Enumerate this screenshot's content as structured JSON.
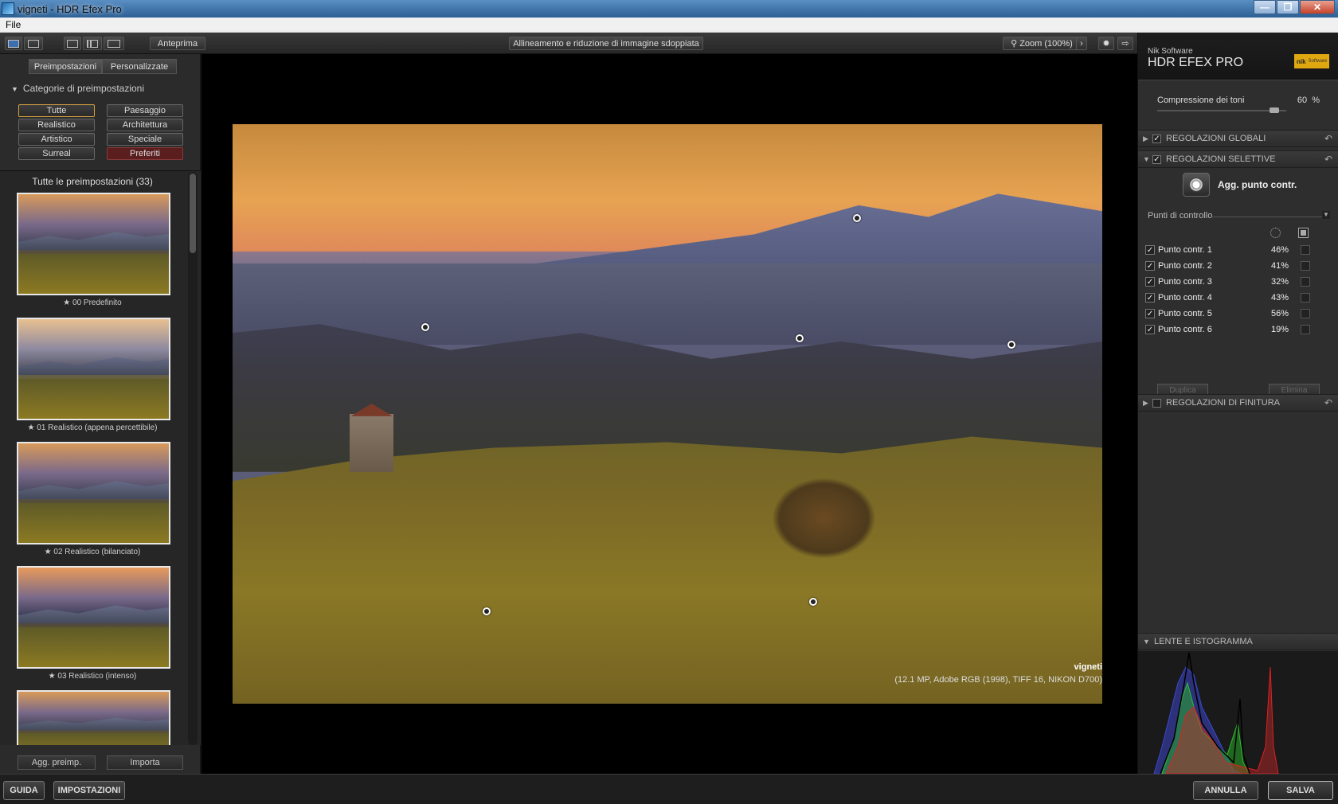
{
  "window": {
    "title": "vigneti - HDR Efex Pro"
  },
  "menu": {
    "file": "File"
  },
  "toolbar": {
    "preview": "Anteprima",
    "align": "Allineamento e riduzione di immagine sdoppiata",
    "zoom": "Zoom (100%)"
  },
  "left": {
    "tab_presets": "Preimpostazioni",
    "tab_custom": "Personalizzate",
    "categories_header": "Categorie di preimpostazioni",
    "categories": [
      "Tutte",
      "Paesaggio",
      "Realistico",
      "Architettura",
      "Artistico",
      "Speciale",
      "Surreal",
      "Preferiti"
    ],
    "list_header": "Tutte le preimpostazioni (33)",
    "presets": [
      "00 Predefinito",
      "01 Realistico (appena percettibile)",
      "02 Realistico (bilanciato)",
      "03 Realistico (intenso)"
    ],
    "add_preset": "Agg. preimp.",
    "import": "Importa"
  },
  "image": {
    "name": "vigneti",
    "info": "(12.1 MP, Adobe RGB (1998), TIFF 16, NIKON D700)"
  },
  "right": {
    "brand_small": "Nik Software",
    "brand_big": "HDR EFEX PRO",
    "logo": "nik",
    "logo_sub": "Software",
    "tone_label": "Compressione dei toni",
    "tone_value": "60",
    "tone_unit": "%",
    "tone_level": 60,
    "global": "REGOLAZIONI GLOBALI",
    "selective": "REGOLAZIONI SELETTIVE",
    "add_cp": "Agg. punto contr.",
    "cp_header": "Punti di controllo",
    "points": [
      {
        "name": "Punto contr. 1",
        "pct": "46%"
      },
      {
        "name": "Punto contr. 2",
        "pct": "41%"
      },
      {
        "name": "Punto contr. 3",
        "pct": "32%"
      },
      {
        "name": "Punto contr. 4",
        "pct": "43%"
      },
      {
        "name": "Punto contr. 5",
        "pct": "56%"
      },
      {
        "name": "Punto contr. 6",
        "pct": "19%"
      }
    ],
    "duplicate": "Duplica",
    "delete": "Elimina",
    "finishing": "REGOLAZIONI DI FINITURA",
    "loupe": "LENTE E ISTOGRAMMA"
  },
  "bottom": {
    "guide": "GUIDA",
    "settings": "IMPOSTAZIONI",
    "cancel": "ANNULLA",
    "save": "SALVA"
  }
}
